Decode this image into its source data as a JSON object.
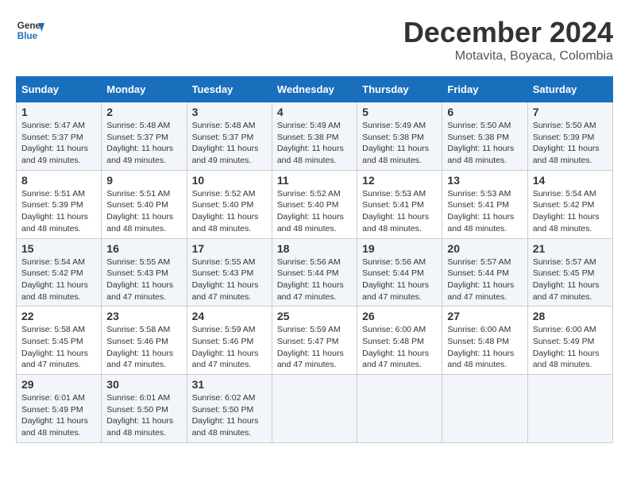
{
  "logo": {
    "text_general": "General",
    "text_blue": "Blue"
  },
  "title": {
    "month": "December 2024",
    "location": "Motavita, Boyaca, Colombia"
  },
  "calendar": {
    "headers": [
      "Sunday",
      "Monday",
      "Tuesday",
      "Wednesday",
      "Thursday",
      "Friday",
      "Saturday"
    ],
    "weeks": [
      [
        {
          "day": "1",
          "sunrise": "5:47 AM",
          "sunset": "5:37 PM",
          "daylight": "11 hours and 49 minutes."
        },
        {
          "day": "2",
          "sunrise": "5:48 AM",
          "sunset": "5:37 PM",
          "daylight": "11 hours and 49 minutes."
        },
        {
          "day": "3",
          "sunrise": "5:48 AM",
          "sunset": "5:37 PM",
          "daylight": "11 hours and 49 minutes."
        },
        {
          "day": "4",
          "sunrise": "5:49 AM",
          "sunset": "5:38 PM",
          "daylight": "11 hours and 48 minutes."
        },
        {
          "day": "5",
          "sunrise": "5:49 AM",
          "sunset": "5:38 PM",
          "daylight": "11 hours and 48 minutes."
        },
        {
          "day": "6",
          "sunrise": "5:50 AM",
          "sunset": "5:38 PM",
          "daylight": "11 hours and 48 minutes."
        },
        {
          "day": "7",
          "sunrise": "5:50 AM",
          "sunset": "5:39 PM",
          "daylight": "11 hours and 48 minutes."
        }
      ],
      [
        {
          "day": "8",
          "sunrise": "5:51 AM",
          "sunset": "5:39 PM",
          "daylight": "11 hours and 48 minutes."
        },
        {
          "day": "9",
          "sunrise": "5:51 AM",
          "sunset": "5:40 PM",
          "daylight": "11 hours and 48 minutes."
        },
        {
          "day": "10",
          "sunrise": "5:52 AM",
          "sunset": "5:40 PM",
          "daylight": "11 hours and 48 minutes."
        },
        {
          "day": "11",
          "sunrise": "5:52 AM",
          "sunset": "5:40 PM",
          "daylight": "11 hours and 48 minutes."
        },
        {
          "day": "12",
          "sunrise": "5:53 AM",
          "sunset": "5:41 PM",
          "daylight": "11 hours and 48 minutes."
        },
        {
          "day": "13",
          "sunrise": "5:53 AM",
          "sunset": "5:41 PM",
          "daylight": "11 hours and 48 minutes."
        },
        {
          "day": "14",
          "sunrise": "5:54 AM",
          "sunset": "5:42 PM",
          "daylight": "11 hours and 48 minutes."
        }
      ],
      [
        {
          "day": "15",
          "sunrise": "5:54 AM",
          "sunset": "5:42 PM",
          "daylight": "11 hours and 48 minutes."
        },
        {
          "day": "16",
          "sunrise": "5:55 AM",
          "sunset": "5:43 PM",
          "daylight": "11 hours and 47 minutes."
        },
        {
          "day": "17",
          "sunrise": "5:55 AM",
          "sunset": "5:43 PM",
          "daylight": "11 hours and 47 minutes."
        },
        {
          "day": "18",
          "sunrise": "5:56 AM",
          "sunset": "5:44 PM",
          "daylight": "11 hours and 47 minutes."
        },
        {
          "day": "19",
          "sunrise": "5:56 AM",
          "sunset": "5:44 PM",
          "daylight": "11 hours and 47 minutes."
        },
        {
          "day": "20",
          "sunrise": "5:57 AM",
          "sunset": "5:44 PM",
          "daylight": "11 hours and 47 minutes."
        },
        {
          "day": "21",
          "sunrise": "5:57 AM",
          "sunset": "5:45 PM",
          "daylight": "11 hours and 47 minutes."
        }
      ],
      [
        {
          "day": "22",
          "sunrise": "5:58 AM",
          "sunset": "5:45 PM",
          "daylight": "11 hours and 47 minutes."
        },
        {
          "day": "23",
          "sunrise": "5:58 AM",
          "sunset": "5:46 PM",
          "daylight": "11 hours and 47 minutes."
        },
        {
          "day": "24",
          "sunrise": "5:59 AM",
          "sunset": "5:46 PM",
          "daylight": "11 hours and 47 minutes."
        },
        {
          "day": "25",
          "sunrise": "5:59 AM",
          "sunset": "5:47 PM",
          "daylight": "11 hours and 47 minutes."
        },
        {
          "day": "26",
          "sunrise": "6:00 AM",
          "sunset": "5:48 PM",
          "daylight": "11 hours and 47 minutes."
        },
        {
          "day": "27",
          "sunrise": "6:00 AM",
          "sunset": "5:48 PM",
          "daylight": "11 hours and 48 minutes."
        },
        {
          "day": "28",
          "sunrise": "6:00 AM",
          "sunset": "5:49 PM",
          "daylight": "11 hours and 48 minutes."
        }
      ],
      [
        {
          "day": "29",
          "sunrise": "6:01 AM",
          "sunset": "5:49 PM",
          "daylight": "11 hours and 48 minutes."
        },
        {
          "day": "30",
          "sunrise": "6:01 AM",
          "sunset": "5:50 PM",
          "daylight": "11 hours and 48 minutes."
        },
        {
          "day": "31",
          "sunrise": "6:02 AM",
          "sunset": "5:50 PM",
          "daylight": "11 hours and 48 minutes."
        },
        null,
        null,
        null,
        null
      ]
    ],
    "labels": {
      "sunrise": "Sunrise:",
      "sunset": "Sunset:",
      "daylight": "Daylight:"
    }
  }
}
